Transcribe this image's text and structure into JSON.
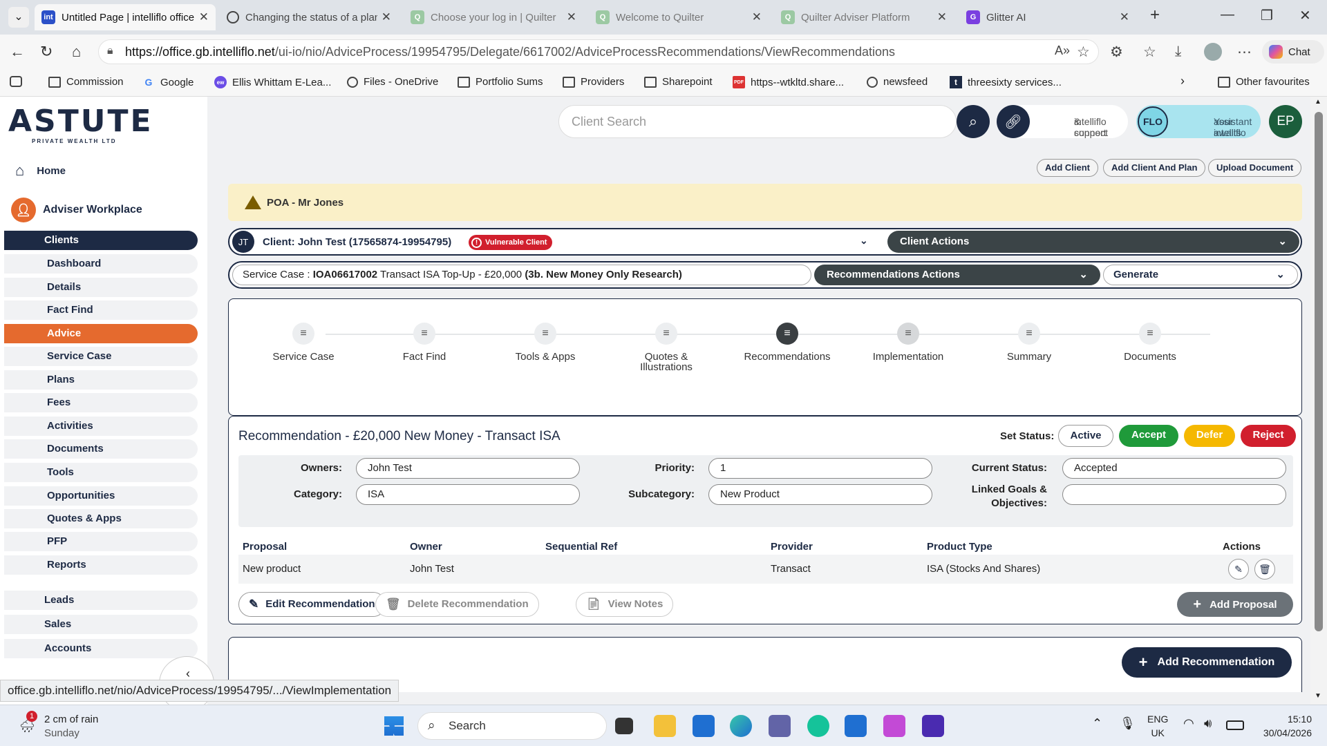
{
  "browser": {
    "tabs": [
      {
        "title": "Untitled Page | intelliflo office",
        "favicon": "int",
        "active": true
      },
      {
        "title": "Changing the status of a plan",
        "favicon": "globe-icon"
      },
      {
        "title": "Choose your log in | Quilter",
        "favicon": "Q"
      },
      {
        "title": "Welcome to Quilter",
        "favicon": "Q"
      },
      {
        "title": "Quilter Adviser Platform",
        "favicon": "Q"
      },
      {
        "title": "Glitter AI",
        "favicon": "G"
      }
    ],
    "url_host": "https://office.gb.intelliflo.net",
    "url_path": "/ui-io/nio/AdviceProcess/19954795/Delegate/6617002/AdviceProcessRecommendations/ViewRecommendations",
    "chat_label": "Chat",
    "bookmarks": [
      "Commission",
      "Google",
      "Ellis Whittam E-Lea...",
      "Files - OneDrive",
      "Portfolio Sums",
      "Providers",
      "Sharepoint",
      "https--wtkltd.share...",
      "newsfeed",
      "threesixty services..."
    ],
    "other_favourites": "Other favourites"
  },
  "sidebar": {
    "logo_text": "ASTUTE",
    "logo_sub": "PRIVATE WEALTH LTD",
    "home": "Home",
    "workplace": "Adviser Workplace",
    "items": [
      "Clients",
      "Dashboard",
      "Details",
      "Fact Find",
      "Advice",
      "Service Case",
      "Plans",
      "Fees",
      "Activities",
      "Documents",
      "Tools",
      "Opportunities",
      "Quotes & Apps",
      "PFP",
      "Reports"
    ],
    "groups": [
      "Leads",
      "Sales",
      "Accounts"
    ]
  },
  "header": {
    "search_placeholder": "Client Search",
    "connect_line1": "intelliflo connect",
    "connect_line2": "& support",
    "flo_badge": "FLO",
    "flo_line1": "Your intelliflo",
    "flo_line2": "assistant awaits",
    "avatar": "EP",
    "buttons": [
      "Add Client",
      "Add Client And Plan",
      "Upload Document"
    ]
  },
  "alert": "POA - Mr Jones",
  "client": {
    "initials": "JT",
    "label": "Client: John Test (17565874-19954795)",
    "badge": "Vulnerable Client",
    "actions": "Client Actions"
  },
  "service_case": {
    "prefix": "Service Case : ",
    "ref": "IOA06617002",
    "desc": " Transact ISA Top-Up - £20,000 ",
    "type": "(3b. New Money Only Research)",
    "rec_actions": "Recommendations Actions",
    "generate": "Generate"
  },
  "steps": [
    {
      "label": "Service Case"
    },
    {
      "label": "Fact Find"
    },
    {
      "label": "Tools & Apps"
    },
    {
      "label": "Quotes & Illustrations"
    },
    {
      "label": "Recommendations",
      "current": true
    },
    {
      "label": "Implementation"
    },
    {
      "label": "Summary"
    },
    {
      "label": "Documents"
    }
  ],
  "recommendation": {
    "title": "Recommendation - £20,000 New Money - Transact ISA",
    "set_status": "Set Status:",
    "status_buttons": {
      "active": "Active",
      "accept": "Accept",
      "defer": "Defer",
      "reject": "Reject"
    },
    "owners_label": "Owners:",
    "owners": "John Test",
    "category_label": "Category:",
    "category": "ISA",
    "priority_label": "Priority:",
    "priority": "1",
    "subcategory_label": "Subcategory:",
    "subcategory": "New Product",
    "status_label": "Current Status:",
    "status": "Accepted",
    "goals_label_1": "Linked Goals &",
    "goals_label_2": "Objectives:",
    "goals": "",
    "columns": [
      "Proposal",
      "Owner",
      "Sequential Ref",
      "Provider",
      "Product Type",
      "Actions"
    ],
    "row": {
      "proposal": "New product",
      "owner": "John Test",
      "seq": "",
      "provider": "Transact",
      "product": "ISA (Stocks And Shares)"
    },
    "edit": "Edit Recommendation",
    "delete": "Delete Recommendation",
    "notes": "View Notes",
    "add_proposal": "Add Proposal",
    "add_recommendation": "Add Recommendation"
  },
  "status_url": "office.gb.intelliflo.net/nio/AdviceProcess/19954795/.../ViewImplementation",
  "taskbar": {
    "weather": "2 cm of rain",
    "day": "Sunday",
    "weather_badge": "1",
    "search": "Search",
    "lang1": "ENG",
    "lang2": "UK",
    "time": "15:10",
    "date": "30/04/2026"
  },
  "colors": {
    "navy": "#1d2a44",
    "orange": "#e56a2e",
    "accept": "#1f9a3a",
    "defer": "#f5b800",
    "reject": "#d11f2d"
  }
}
